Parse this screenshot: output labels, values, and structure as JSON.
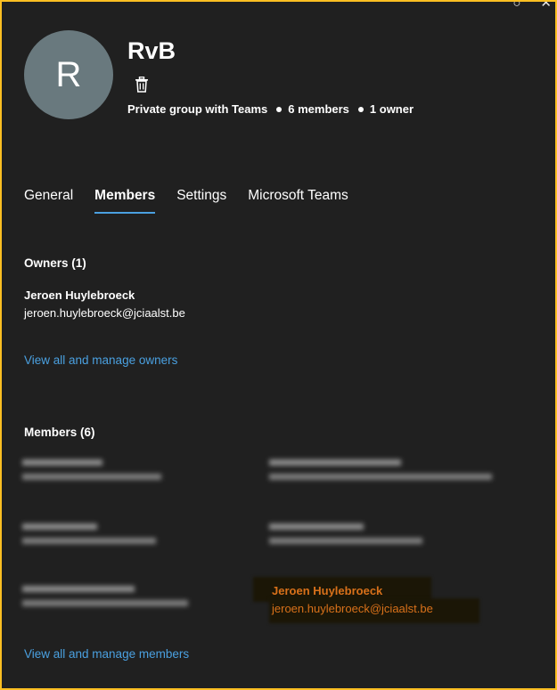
{
  "window": {
    "minimize_glyph": "○",
    "close_glyph": "✕"
  },
  "group": {
    "avatar_initial": "R",
    "name": "RvB",
    "type": "Private group with Teams",
    "members_count": "6 members",
    "owners_count": "1 owner"
  },
  "tabs": [
    {
      "label": "General",
      "active": false
    },
    {
      "label": "Members",
      "active": true
    },
    {
      "label": "Settings",
      "active": false
    },
    {
      "label": "Microsoft Teams",
      "active": false
    }
  ],
  "owners": {
    "title": "Owners (1)",
    "items": [
      {
        "name": "Jeroen Huylebroeck",
        "email": "jeroen.huylebroeck@jciaalst.be"
      }
    ],
    "manage_link": "View all and manage owners"
  },
  "members": {
    "title": "Members (6)",
    "highlighted": {
      "name": "Jeroen Huylebroeck",
      "email": "jeroen.huylebroeck@jciaalst.be"
    },
    "manage_link": "View all and manage members"
  },
  "colors": {
    "accent": "#4aa0e0",
    "highlight_text": "#d9711a",
    "background": "#202020",
    "border": "#fbbf22",
    "avatar": "#69797e"
  },
  "icons": {
    "delete": "trash-icon"
  }
}
